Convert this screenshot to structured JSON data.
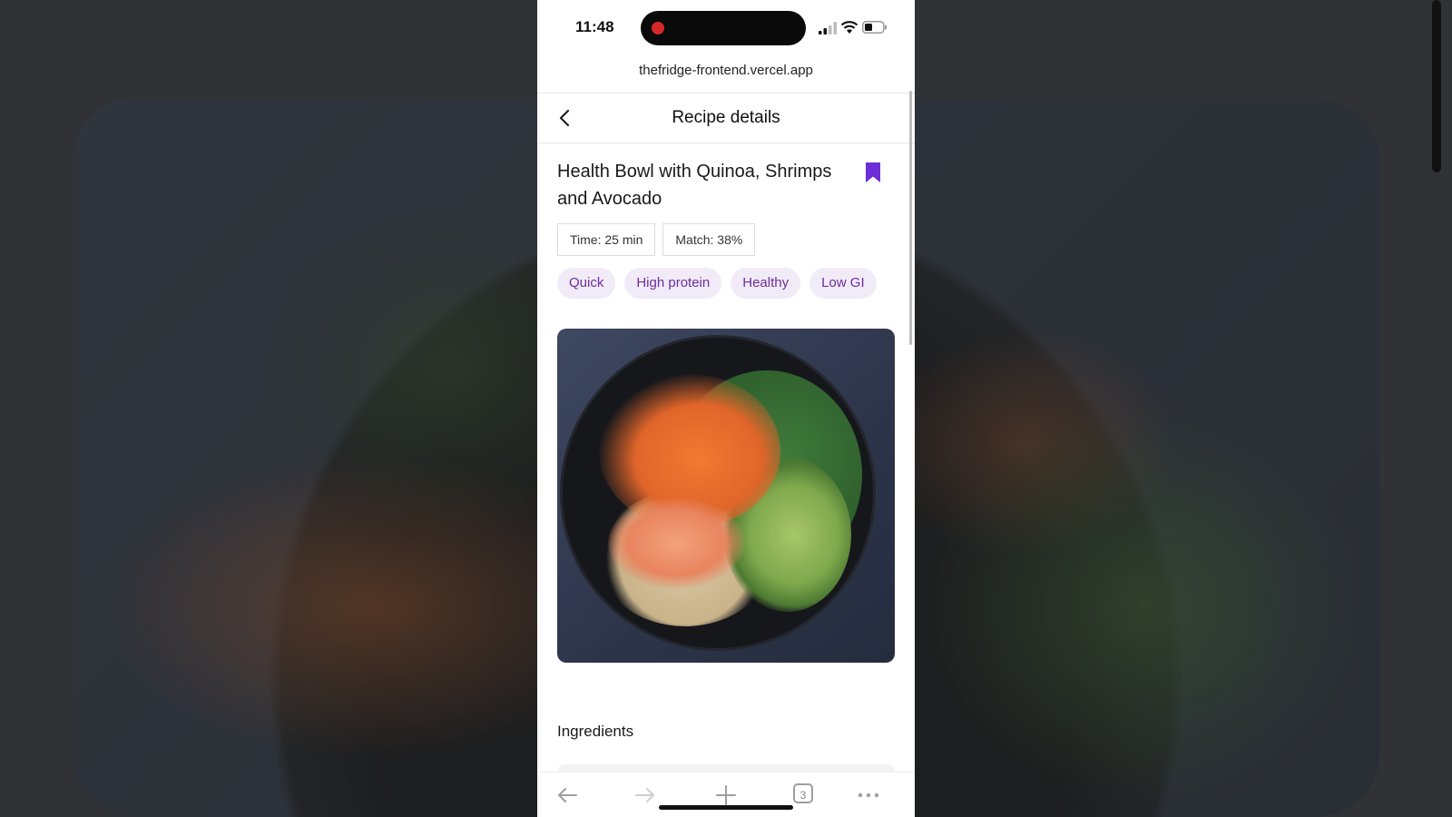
{
  "status_bar": {
    "time": "11:48"
  },
  "browser": {
    "url": "thefridge-frontend.vercel.app",
    "tabs_count": "3"
  },
  "header": {
    "title": "Recipe details"
  },
  "recipe": {
    "title": "Health Bowl with Quinoa, Shrimps and Avocado",
    "time": "Time: 25 min",
    "match": "Match: 38%",
    "tags": [
      "Quick",
      "High protein",
      "Healthy",
      "Low GI"
    ]
  },
  "sections": {
    "ingredients": "Ingredients"
  },
  "colors": {
    "accent": "#6d2dd8",
    "tag_bg": "#f1ebf8",
    "tag_text": "#6d2d9c"
  },
  "icons": {
    "back": "chevron-left-icon",
    "bookmark": "bookmark-icon",
    "nav_back": "arrow-left-icon",
    "nav_forward": "arrow-right-icon",
    "new_tab": "plus-icon",
    "tabs": "tabs-icon",
    "more": "more-icon"
  }
}
